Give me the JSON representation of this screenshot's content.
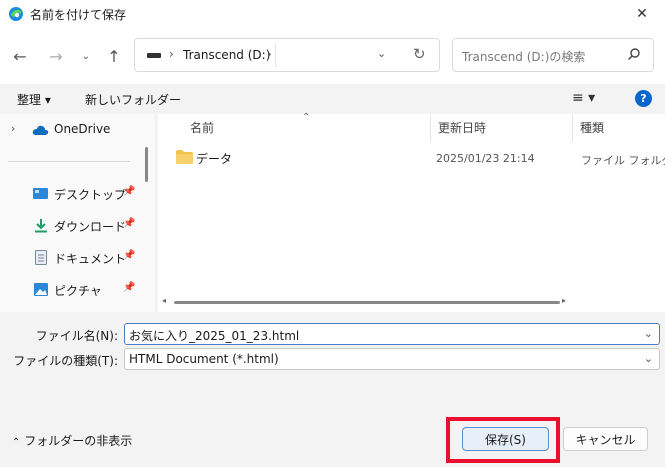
{
  "window": {
    "title": "名前を付けて保存"
  },
  "address": {
    "location": "Transcend (D:)"
  },
  "search": {
    "placeholder": "Transcend (D:)の検索"
  },
  "toolbar": {
    "organize_label": "整理 ▾",
    "new_folder_label": "新しいフォルダー"
  },
  "sidebar": {
    "items": [
      {
        "label": "OneDrive",
        "icon": "onedrive-icon"
      },
      {
        "label": "デスクトップ",
        "icon": "desktop-icon",
        "pinned": true
      },
      {
        "label": "ダウンロード",
        "icon": "download-icon",
        "pinned": true
      },
      {
        "label": "ドキュメント",
        "icon": "document-icon",
        "pinned": true
      },
      {
        "label": "ピクチャ",
        "icon": "pictures-icon",
        "pinned": true
      }
    ]
  },
  "columns": {
    "name": "名前",
    "modified": "更新日時",
    "type": "種類"
  },
  "files": [
    {
      "name": "データ",
      "modified": "2025/01/23 21:14",
      "type": "ファイル フォルダー"
    }
  ],
  "form": {
    "filename_label": "ファイル名(N):",
    "filename_value": "お気に入り_2025_01_23.html",
    "filetype_label": "ファイルの種類(T):",
    "filetype_value": "HTML Document (*.html)"
  },
  "footer": {
    "hide_folders_label": "フォルダーの非表示",
    "save_label": "保存(S)",
    "cancel_label": "キャンセル"
  },
  "colors": {
    "accent": "#0a66cc",
    "highlight": "#e8102e",
    "folder": "#f2c14e"
  }
}
